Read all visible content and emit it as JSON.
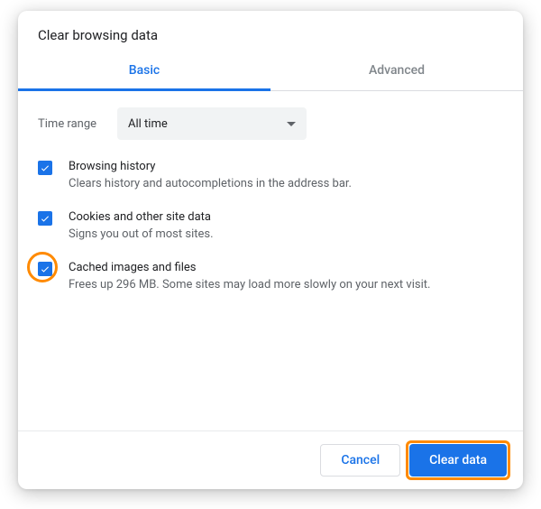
{
  "dialog": {
    "title": "Clear browsing data"
  },
  "tabs": {
    "basic": "Basic",
    "advanced": "Advanced"
  },
  "range": {
    "label": "Time range",
    "value": "All time"
  },
  "options": [
    {
      "title": "Browsing history",
      "desc": "Clears history and autocompletions in the address bar.",
      "checked": true,
      "highlight": false
    },
    {
      "title": "Cookies and other site data",
      "desc": "Signs you out of most sites.",
      "checked": true,
      "highlight": false
    },
    {
      "title": "Cached images and files",
      "desc": "Frees up 296 MB. Some sites may load more slowly on your next visit.",
      "checked": true,
      "highlight": true
    }
  ],
  "footer": {
    "cancel": "Cancel",
    "clear": "Clear data"
  },
  "colors": {
    "accent": "#1a73e8",
    "highlight": "#ff8a00"
  }
}
